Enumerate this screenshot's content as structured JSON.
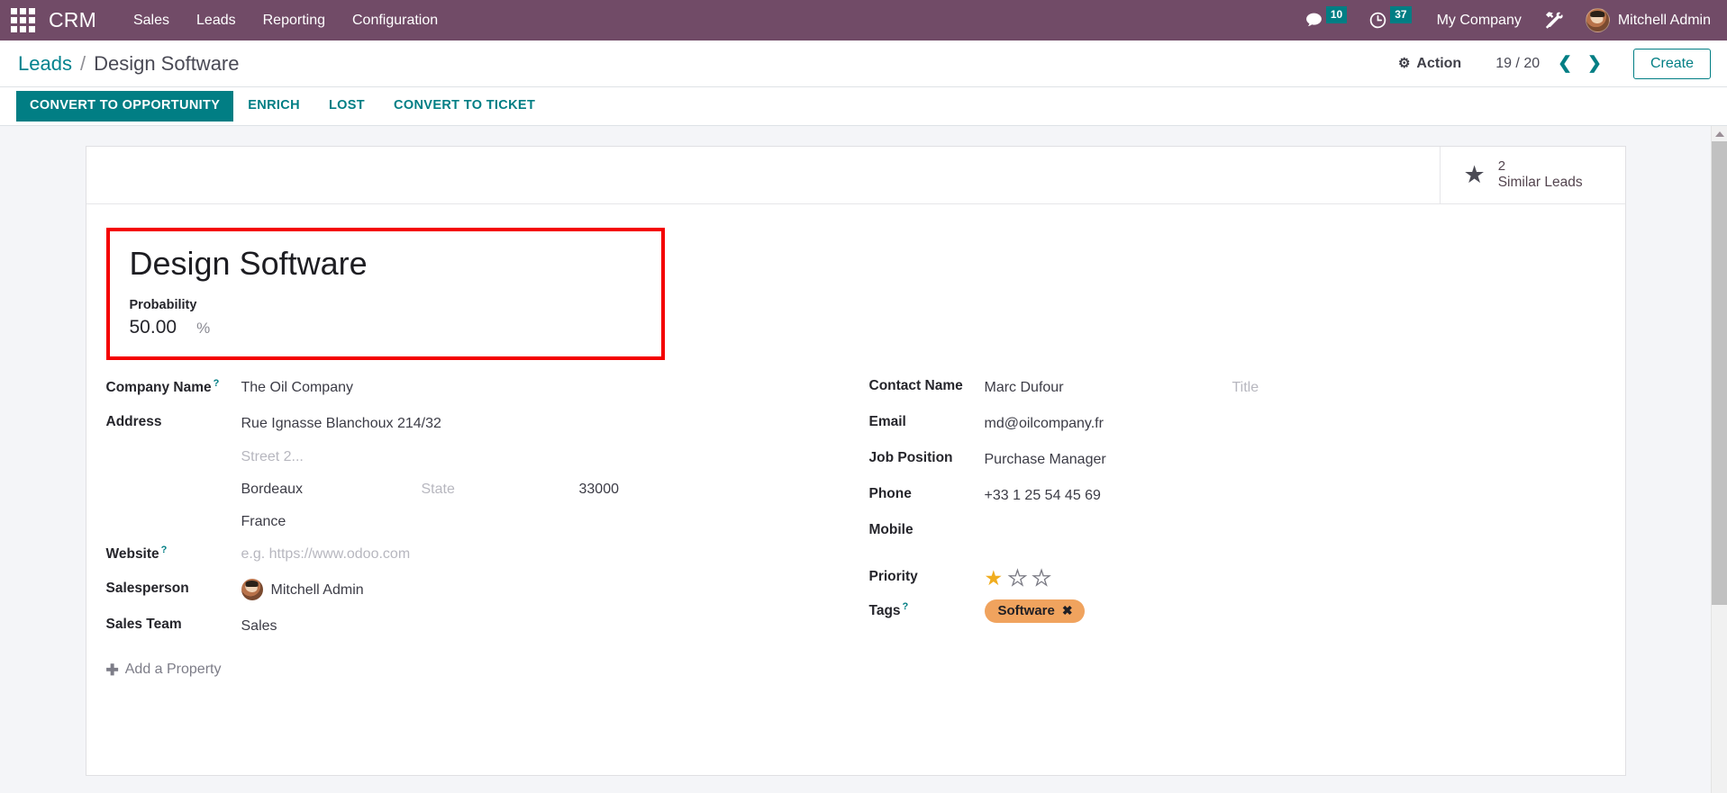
{
  "navbar": {
    "apps_icon": "apps-grid-icon",
    "brand": "CRM",
    "menu": [
      {
        "label": "Sales"
      },
      {
        "label": "Leads"
      },
      {
        "label": "Reporting"
      },
      {
        "label": "Configuration"
      }
    ],
    "messages": {
      "icon": "chat-bubble-icon",
      "count": "10"
    },
    "activities": {
      "icon": "clock-icon",
      "count": "37"
    },
    "company": "My Company",
    "tools_icon": "wrench-screwdriver-icon",
    "user": {
      "name": "Mitchell Admin",
      "avatar": "user-avatar"
    },
    "accent_color": "#714B67",
    "badge_color": "#017e84"
  },
  "control_panel": {
    "breadcrumb": {
      "root": "Leads",
      "separator": "/",
      "current": "Design Software"
    },
    "action": {
      "label": "Action",
      "icon": "gear-icon"
    },
    "pager": {
      "text": "19 / 20",
      "prev_icon": "chevron-left-icon",
      "next_icon": "chevron-right-icon"
    },
    "create_label": "Create"
  },
  "action_buttons": {
    "primary": "CONVERT TO OPPORTUNITY",
    "secondary": [
      "ENRICH",
      "LOST",
      "CONVERT TO TICKET"
    ],
    "primary_color": "#017e84"
  },
  "stat_buttons": [
    {
      "icon": "star-icon",
      "value": "2",
      "label": "Similar Leads"
    }
  ],
  "record": {
    "title": "Design Software",
    "highlight_color": "#f40000",
    "probability": {
      "label": "Probability",
      "value": "50.00",
      "suffix": "%"
    }
  },
  "fields_left": {
    "company_name": {
      "label": "Company Name",
      "help": "?",
      "value": "The Oil Company"
    },
    "address": {
      "label": "Address",
      "street": "Rue Ignasse Blanchoux 214/32",
      "street2_placeholder": "Street 2...",
      "city": "Bordeaux",
      "state_placeholder": "State",
      "zip": "33000",
      "country": "France"
    },
    "website": {
      "label": "Website",
      "help": "?",
      "placeholder": "e.g. https://www.odoo.com"
    },
    "salesperson": {
      "label": "Salesperson",
      "value": "Mitchell Admin",
      "avatar": "user-avatar"
    },
    "sales_team": {
      "label": "Sales Team",
      "value": "Sales"
    },
    "add_property": {
      "label": "Add a Property",
      "icon": "plus-icon"
    }
  },
  "fields_right": {
    "contact_name": {
      "label": "Contact Name",
      "value": "Marc Dufour",
      "title_placeholder": "Title"
    },
    "email": {
      "label": "Email",
      "value": "md@oilcompany.fr"
    },
    "job_position": {
      "label": "Job Position",
      "value": "Purchase Manager"
    },
    "phone": {
      "label": "Phone",
      "value": "+33 1 25 54 45 69"
    },
    "mobile": {
      "label": "Mobile",
      "value": ""
    },
    "priority": {
      "label": "Priority",
      "filled": 1,
      "total": 3,
      "star_color": "#f0ad1f"
    },
    "tags": {
      "label": "Tags",
      "help": "?",
      "items": [
        {
          "name": "Software",
          "color": "#f0a35e",
          "remove_icon": "close-icon"
        }
      ]
    }
  }
}
